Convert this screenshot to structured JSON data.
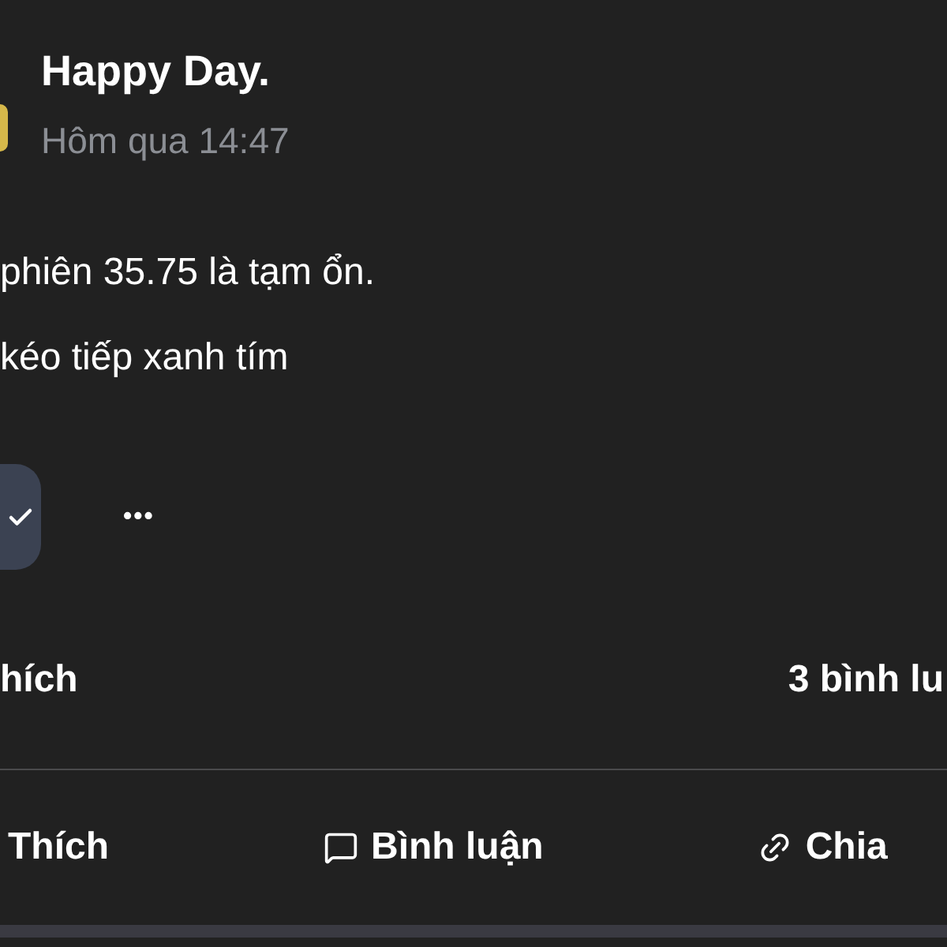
{
  "post": {
    "author": "Happy Day.",
    "time": "Hôm qua 14:47",
    "body": [
      "phiên 35.75 là tạm ổn.",
      "kéo tiếp xanh tím"
    ],
    "more": "•••",
    "likes": "hích",
    "comments": "3 bình lu",
    "actions": [
      {
        "kind": "like",
        "label": "Thích"
      },
      {
        "kind": "comment",
        "label": "Bình luận"
      },
      {
        "kind": "share",
        "label": "Chia"
      }
    ]
  }
}
